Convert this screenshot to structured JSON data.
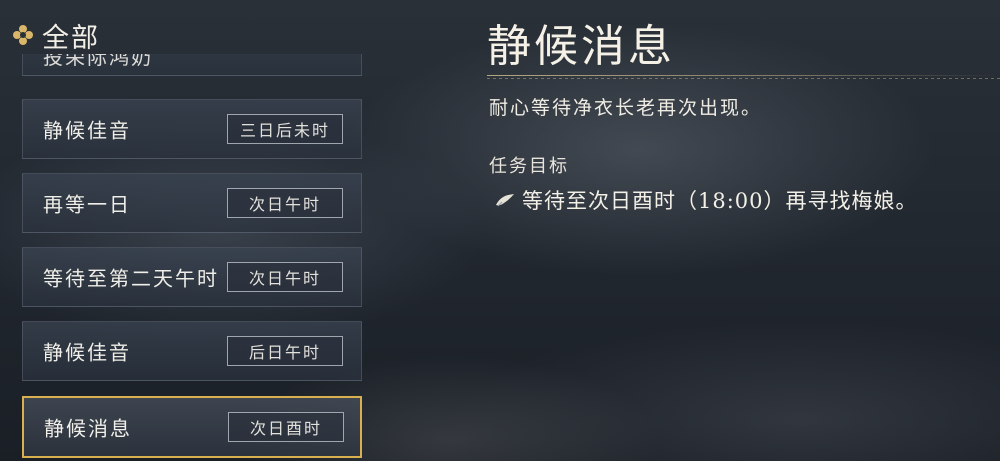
{
  "sidebar": {
    "header": {
      "icon": "diamond-ornament-icon",
      "label": "全部"
    },
    "items": [
      {
        "name": "投荣际鸿奶",
        "time": "",
        "partial": true
      },
      {
        "name": "静候佳音",
        "time": "三日后未时"
      },
      {
        "name": "再等一日",
        "time": "次日午时"
      },
      {
        "name": "等待至第二天午时",
        "time": "次日午时"
      },
      {
        "name": "静候佳音",
        "time": "后日午时"
      },
      {
        "name": "静候消息",
        "time": "次日酉时",
        "selected": true
      }
    ]
  },
  "detail": {
    "title": "静候消息",
    "description": "耐心等待净衣长老再次出现。",
    "objective_label": "任务目标",
    "objective_icon": "brush-stroke-icon",
    "objective_text": "等待至次日酉时（18:00）再寻找梅娘。"
  },
  "colors": {
    "selected_border": "#d8b050",
    "divider": "#cdb98c",
    "text": "#f0eee8"
  }
}
